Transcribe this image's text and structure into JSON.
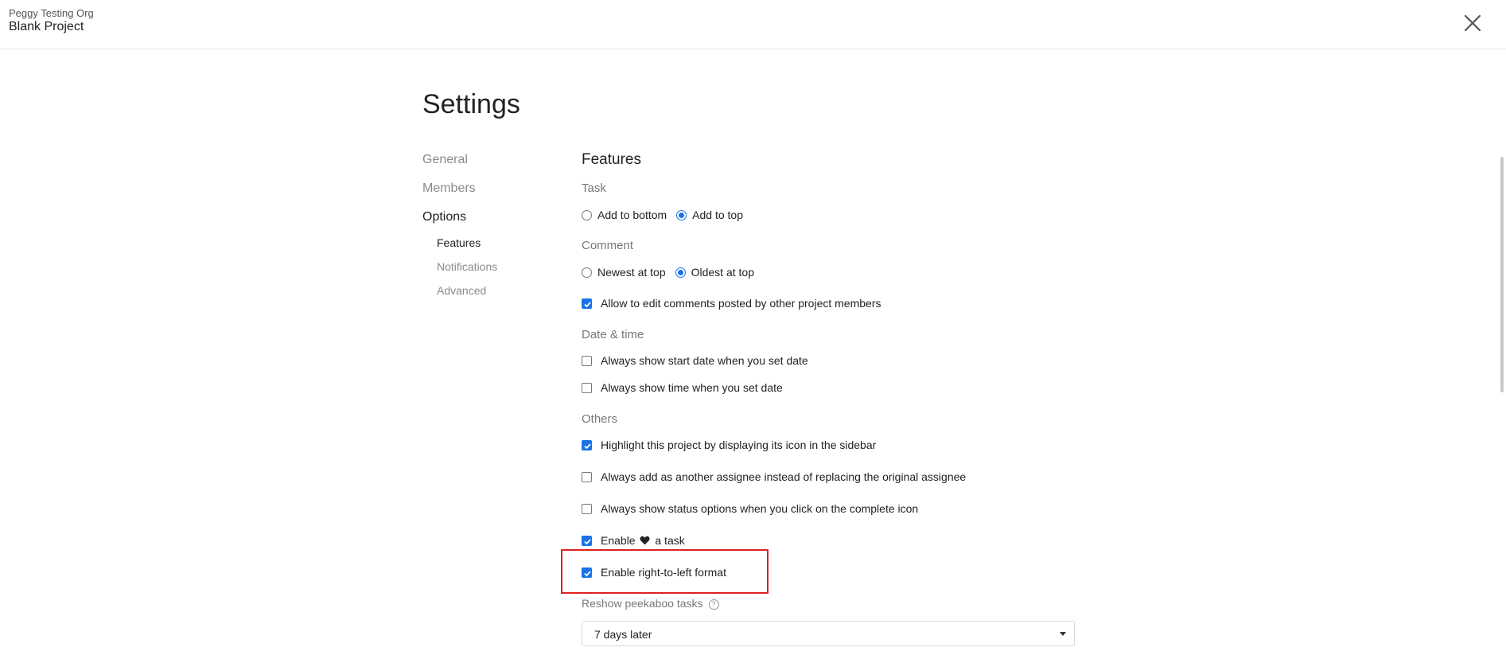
{
  "header": {
    "org_name": "Peggy Testing Org",
    "project_name": "Blank Project"
  },
  "page_title": "Settings",
  "nav": {
    "general": "General",
    "members": "Members",
    "options": "Options",
    "features": "Features",
    "notifications": "Notifications",
    "advanced": "Advanced"
  },
  "features": {
    "title": "Features",
    "task": {
      "label": "Task",
      "add_to_bottom": "Add to bottom",
      "add_to_top": "Add to top",
      "selected": "Add to top"
    },
    "comment": {
      "label": "Comment",
      "newest_at_top": "Newest at top",
      "oldest_at_top": "Oldest at top",
      "selected": "Oldest at top",
      "allow_edit": "Allow to edit comments posted by other project members"
    },
    "date_time": {
      "label": "Date & time",
      "show_start_date": "Always show start date when you set date",
      "show_time": "Always show time when you set date"
    },
    "others": {
      "label": "Others",
      "highlight_project": "Highlight this project by displaying its icon in the sidebar",
      "add_assignee": "Always add as another assignee instead of replacing the original assignee",
      "show_status_options": "Always show status options when you click on the complete icon",
      "enable_heart_prefix": "Enable",
      "enable_heart_suffix": "a task",
      "enable_rtl": "Enable right-to-left format"
    },
    "reshow": {
      "label": "Reshow peekaboo tasks",
      "help_glyph": "?",
      "value": "7 days later"
    }
  },
  "checkbox_states": {
    "allow_edit": true,
    "show_start_date": false,
    "show_time": false,
    "highlight_project": true,
    "add_assignee": false,
    "show_status_options": false,
    "enable_heart": true,
    "enable_rtl": true
  },
  "colors": {
    "accent": "#1a73e8",
    "highlight_border": "#e02020"
  }
}
